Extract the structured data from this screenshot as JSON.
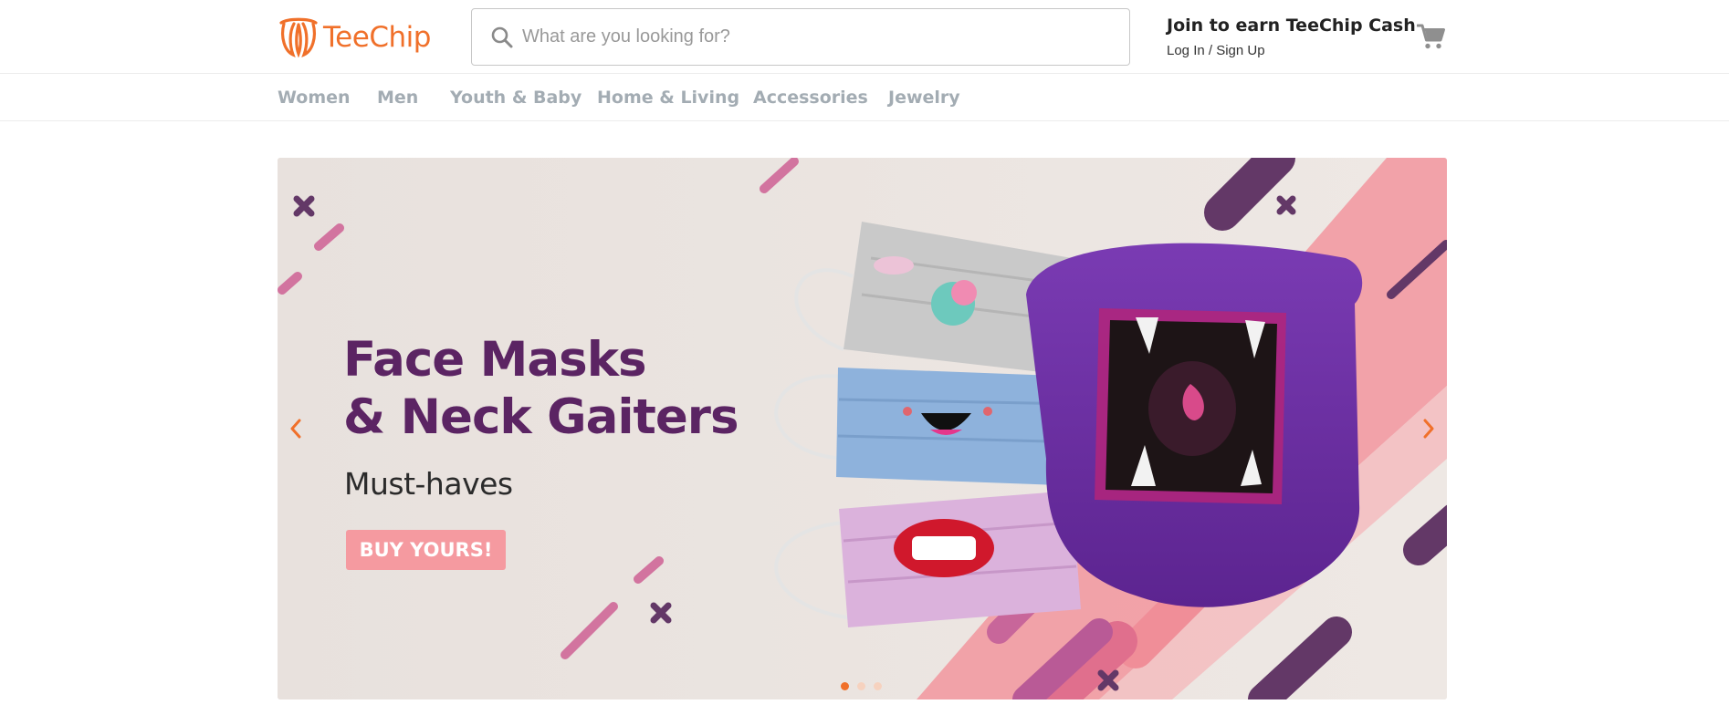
{
  "brand": {
    "name": "TeeChip",
    "color": "#f0702a",
    "logo_icon": "teechip-logo-icon"
  },
  "search": {
    "placeholder": "What are you looking for?",
    "value": "",
    "icon": "search-icon"
  },
  "account": {
    "promo": "Join to earn TeeChip Cash",
    "auth_label": "Log In / Sign Up"
  },
  "cart": {
    "icon": "shopping-cart-icon"
  },
  "nav": {
    "items": [
      {
        "label": "Women"
      },
      {
        "label": "Men"
      },
      {
        "label": "Youth & Baby"
      },
      {
        "label": "Home & Living"
      },
      {
        "label": "Accessories"
      },
      {
        "label": "Jewelry"
      }
    ]
  },
  "banner": {
    "title_line1": "Face Masks",
    "title_line2": "& Neck Gaiters",
    "subtitle": "Must-haves",
    "cta_label": "BUY YOURS!",
    "prev_icon": "chevron-left-icon",
    "next_icon": "chevron-right-icon",
    "slide_count": 3,
    "active_slide": 1,
    "colors": {
      "background": "#ece5e1",
      "title": "#5b2463",
      "cta": "#f59aa0",
      "accent_pink": "#f08e98",
      "accent_purple": "#633867",
      "gaiter": "#6a2aa0"
    }
  }
}
